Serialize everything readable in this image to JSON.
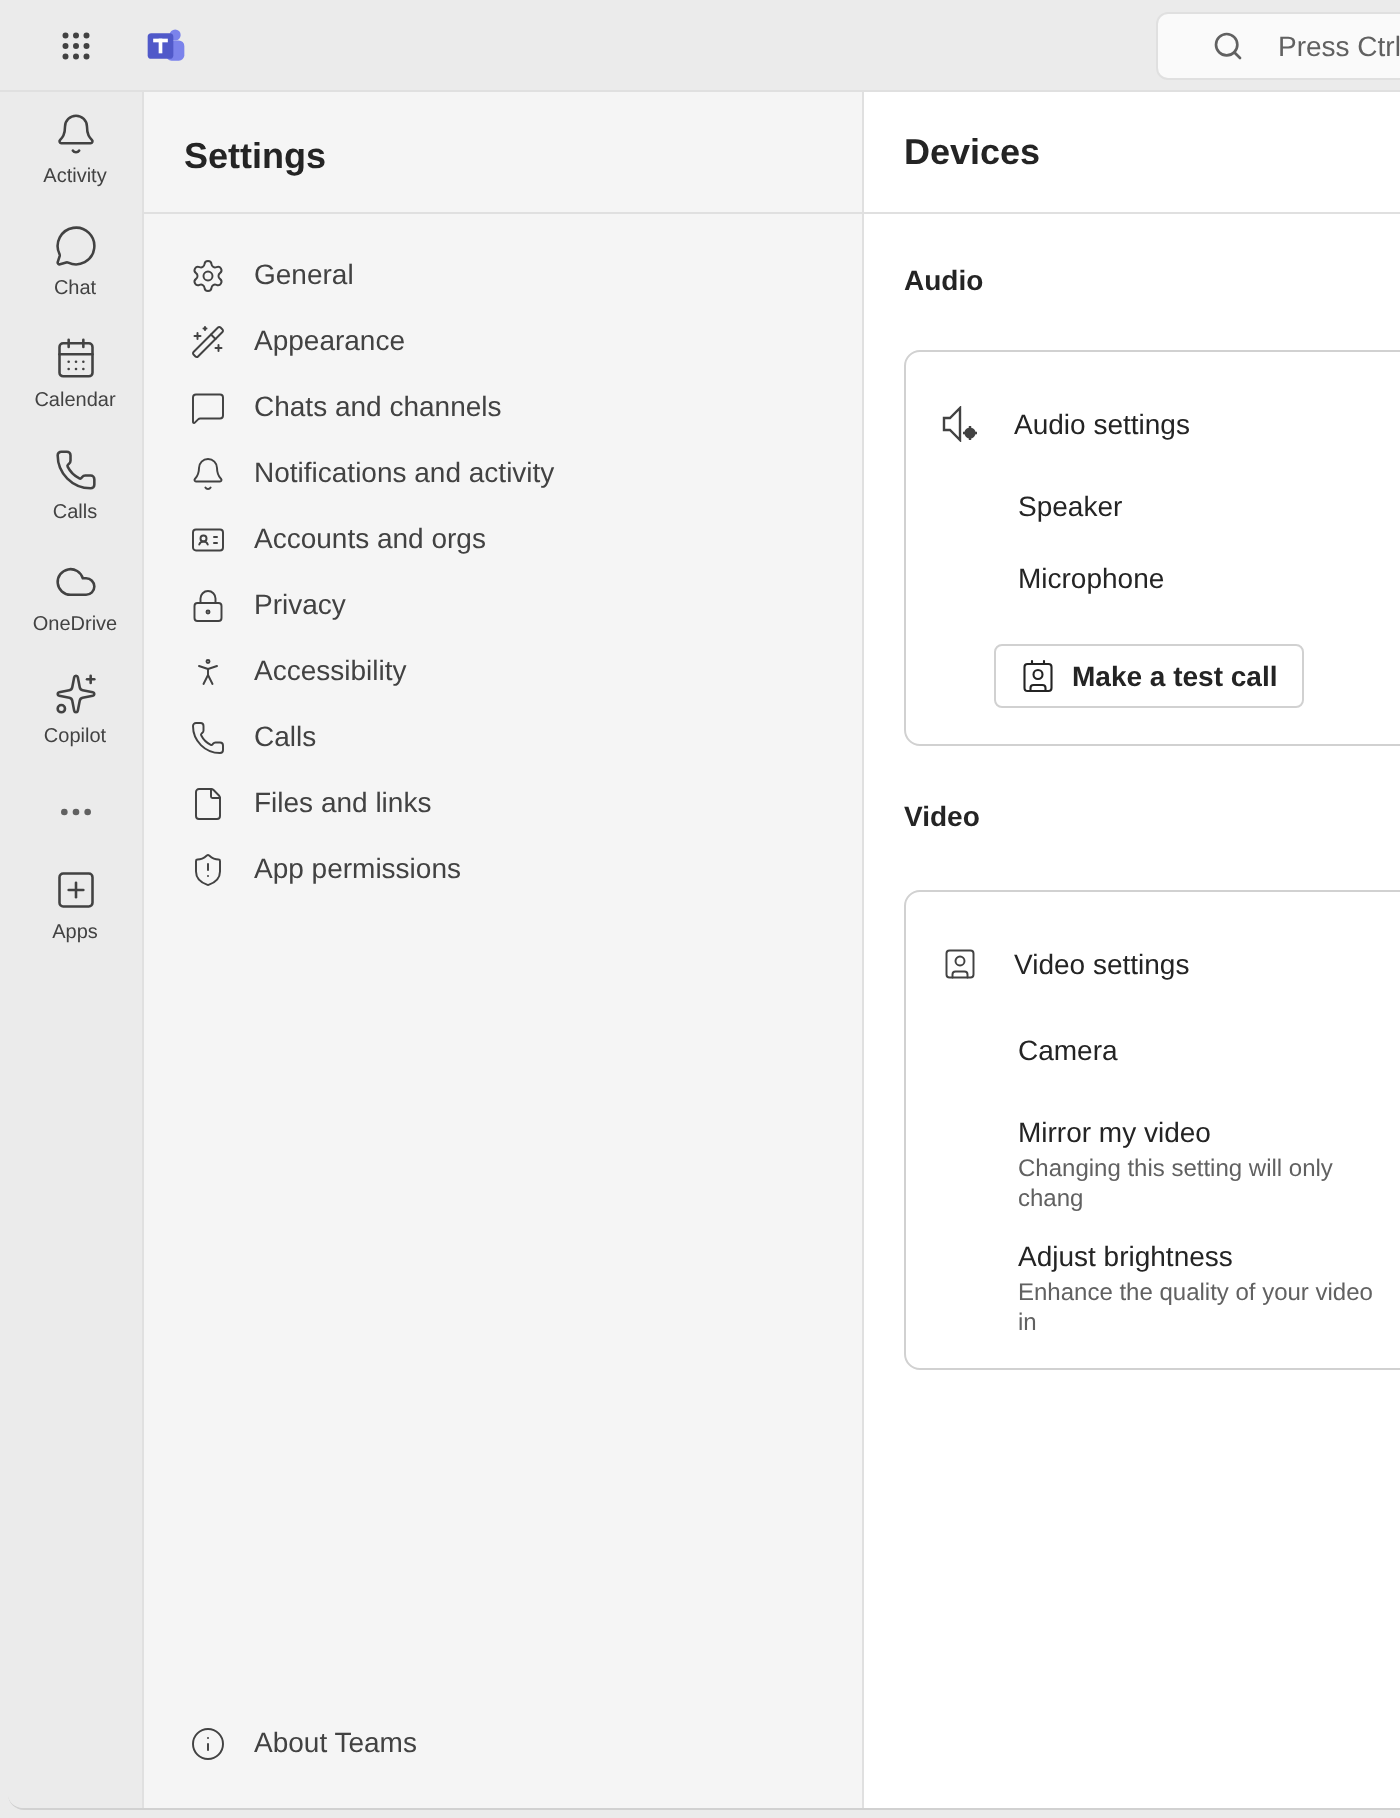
{
  "search": {
    "placeholder": "Press Ctrl"
  },
  "rail": [
    {
      "label": "Activity"
    },
    {
      "label": "Chat"
    },
    {
      "label": "Calendar"
    },
    {
      "label": "Calls"
    },
    {
      "label": "OneDrive"
    },
    {
      "label": "Copilot"
    }
  ],
  "apps": {
    "label": "Apps"
  },
  "settings": {
    "title": "Settings",
    "items": [
      {
        "label": "General"
      },
      {
        "label": "Appearance"
      },
      {
        "label": "Chats and channels"
      },
      {
        "label": "Notifications and activity"
      },
      {
        "label": "Accounts and orgs"
      },
      {
        "label": "Privacy"
      },
      {
        "label": "Accessibility"
      },
      {
        "label": "Calls"
      },
      {
        "label": "Files and links"
      },
      {
        "label": "App permissions"
      }
    ],
    "footer": "About Teams"
  },
  "devices": {
    "title": "Devices",
    "audio": {
      "heading": "Audio",
      "card_title": "Audio settings",
      "rows": [
        {
          "label": "Speaker"
        },
        {
          "label": "Microphone"
        }
      ],
      "button": "Make a test call"
    },
    "video": {
      "heading": "Video",
      "card_title": "Video settings",
      "rows": [
        {
          "label": "Camera"
        },
        {
          "label": "Mirror my video",
          "description": "Changing this setting will only chang"
        },
        {
          "label": "Adjust brightness",
          "description": "Enhance the quality of your video in"
        }
      ]
    }
  }
}
